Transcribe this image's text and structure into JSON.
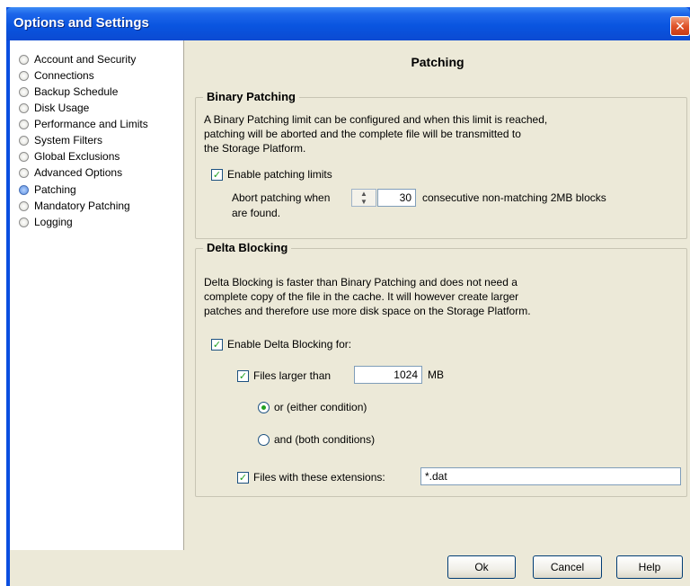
{
  "window": {
    "title": "Options and Settings",
    "close_glyph": "✕"
  },
  "sidebar": {
    "items": [
      {
        "label": "Account and Security",
        "selected": false
      },
      {
        "label": "Connections",
        "selected": false
      },
      {
        "label": "Backup Schedule",
        "selected": false
      },
      {
        "label": "Disk Usage",
        "selected": false
      },
      {
        "label": "Performance and Limits",
        "selected": false
      },
      {
        "label": "System Filters",
        "selected": false
      },
      {
        "label": "Global Exclusions",
        "selected": false
      },
      {
        "label": "Advanced Options",
        "selected": false
      },
      {
        "label": "Patching",
        "selected": true
      },
      {
        "label": "Mandatory Patching",
        "selected": false
      },
      {
        "label": "Logging",
        "selected": false
      }
    ]
  },
  "content": {
    "page_title": "Patching",
    "binary": {
      "legend": "Binary Patching",
      "description": "A Binary Patching limit can be configured and when this limit is reached,\npatching will be aborted and the complete file will be transmitted to\nthe Storage Platform.",
      "enable_label": "Enable patching limits",
      "enable_checked": true,
      "abort_prefix": "Abort patching when",
      "abort_value": "30",
      "abort_suffix": "consecutive non-matching 2MB blocks",
      "abort_suffix2": "are found."
    },
    "delta": {
      "legend": "Delta Blocking",
      "description": "Delta Blocking is faster than Binary Patching and does not need a\ncomplete copy of the file in the cache. It will however create larger\npatches and therefore use more disk space on the Storage Platform.",
      "enable_label": "Enable Delta Blocking for:",
      "enable_checked": true,
      "larger_label": "Files larger than",
      "larger_checked": true,
      "larger_value": "1024",
      "larger_unit": "MB",
      "or_label": "or (either condition)",
      "or_selected": true,
      "and_label": "and (both conditions)",
      "and_selected": false,
      "ext_label": "Files with these extensions:",
      "ext_checked": true,
      "ext_value": "*.dat"
    }
  },
  "footer": {
    "ok": "Ok",
    "cancel": "Cancel",
    "help": "Help"
  },
  "glyphs": {
    "check": "✓"
  }
}
